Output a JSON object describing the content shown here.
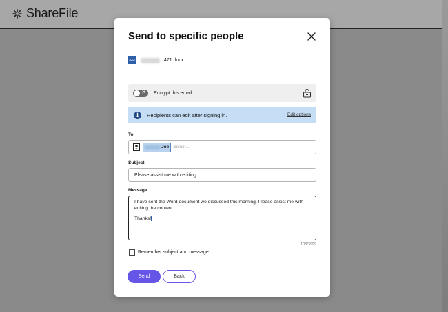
{
  "app": {
    "name": "ShareFile"
  },
  "dialog": {
    "title": "Send to specific people",
    "file": {
      "type_badge": "DOC",
      "name": "471.docx"
    },
    "encrypt": {
      "label": "Encrypt this email",
      "enabled": false
    },
    "info_banner": {
      "text": "Recipients can edit after signing in.",
      "link": "Edit options"
    },
    "to": {
      "label": "To",
      "recipient": "Joe",
      "placeholder": "Select..."
    },
    "subject": {
      "label": "Subject",
      "value": "Please assist me with editing"
    },
    "message": {
      "label": "Message",
      "line1": "I have sent the Word document we discussed this morning. Please assist me with editing the content.",
      "line2": "Thanks!",
      "counter": "108/3999"
    },
    "remember": {
      "label": "Remember subject and message",
      "checked": false
    },
    "buttons": {
      "send": "Send",
      "back": "Back"
    }
  },
  "colors": {
    "primary": "#6556e8",
    "info_bg": "#c5def5",
    "overlay": "#8a8a8a"
  },
  "icons": [
    "sharefile-logo-icon",
    "close-icon",
    "doc-file-icon",
    "toggle-switch",
    "lock-icon",
    "info-icon",
    "contact-icon"
  ]
}
